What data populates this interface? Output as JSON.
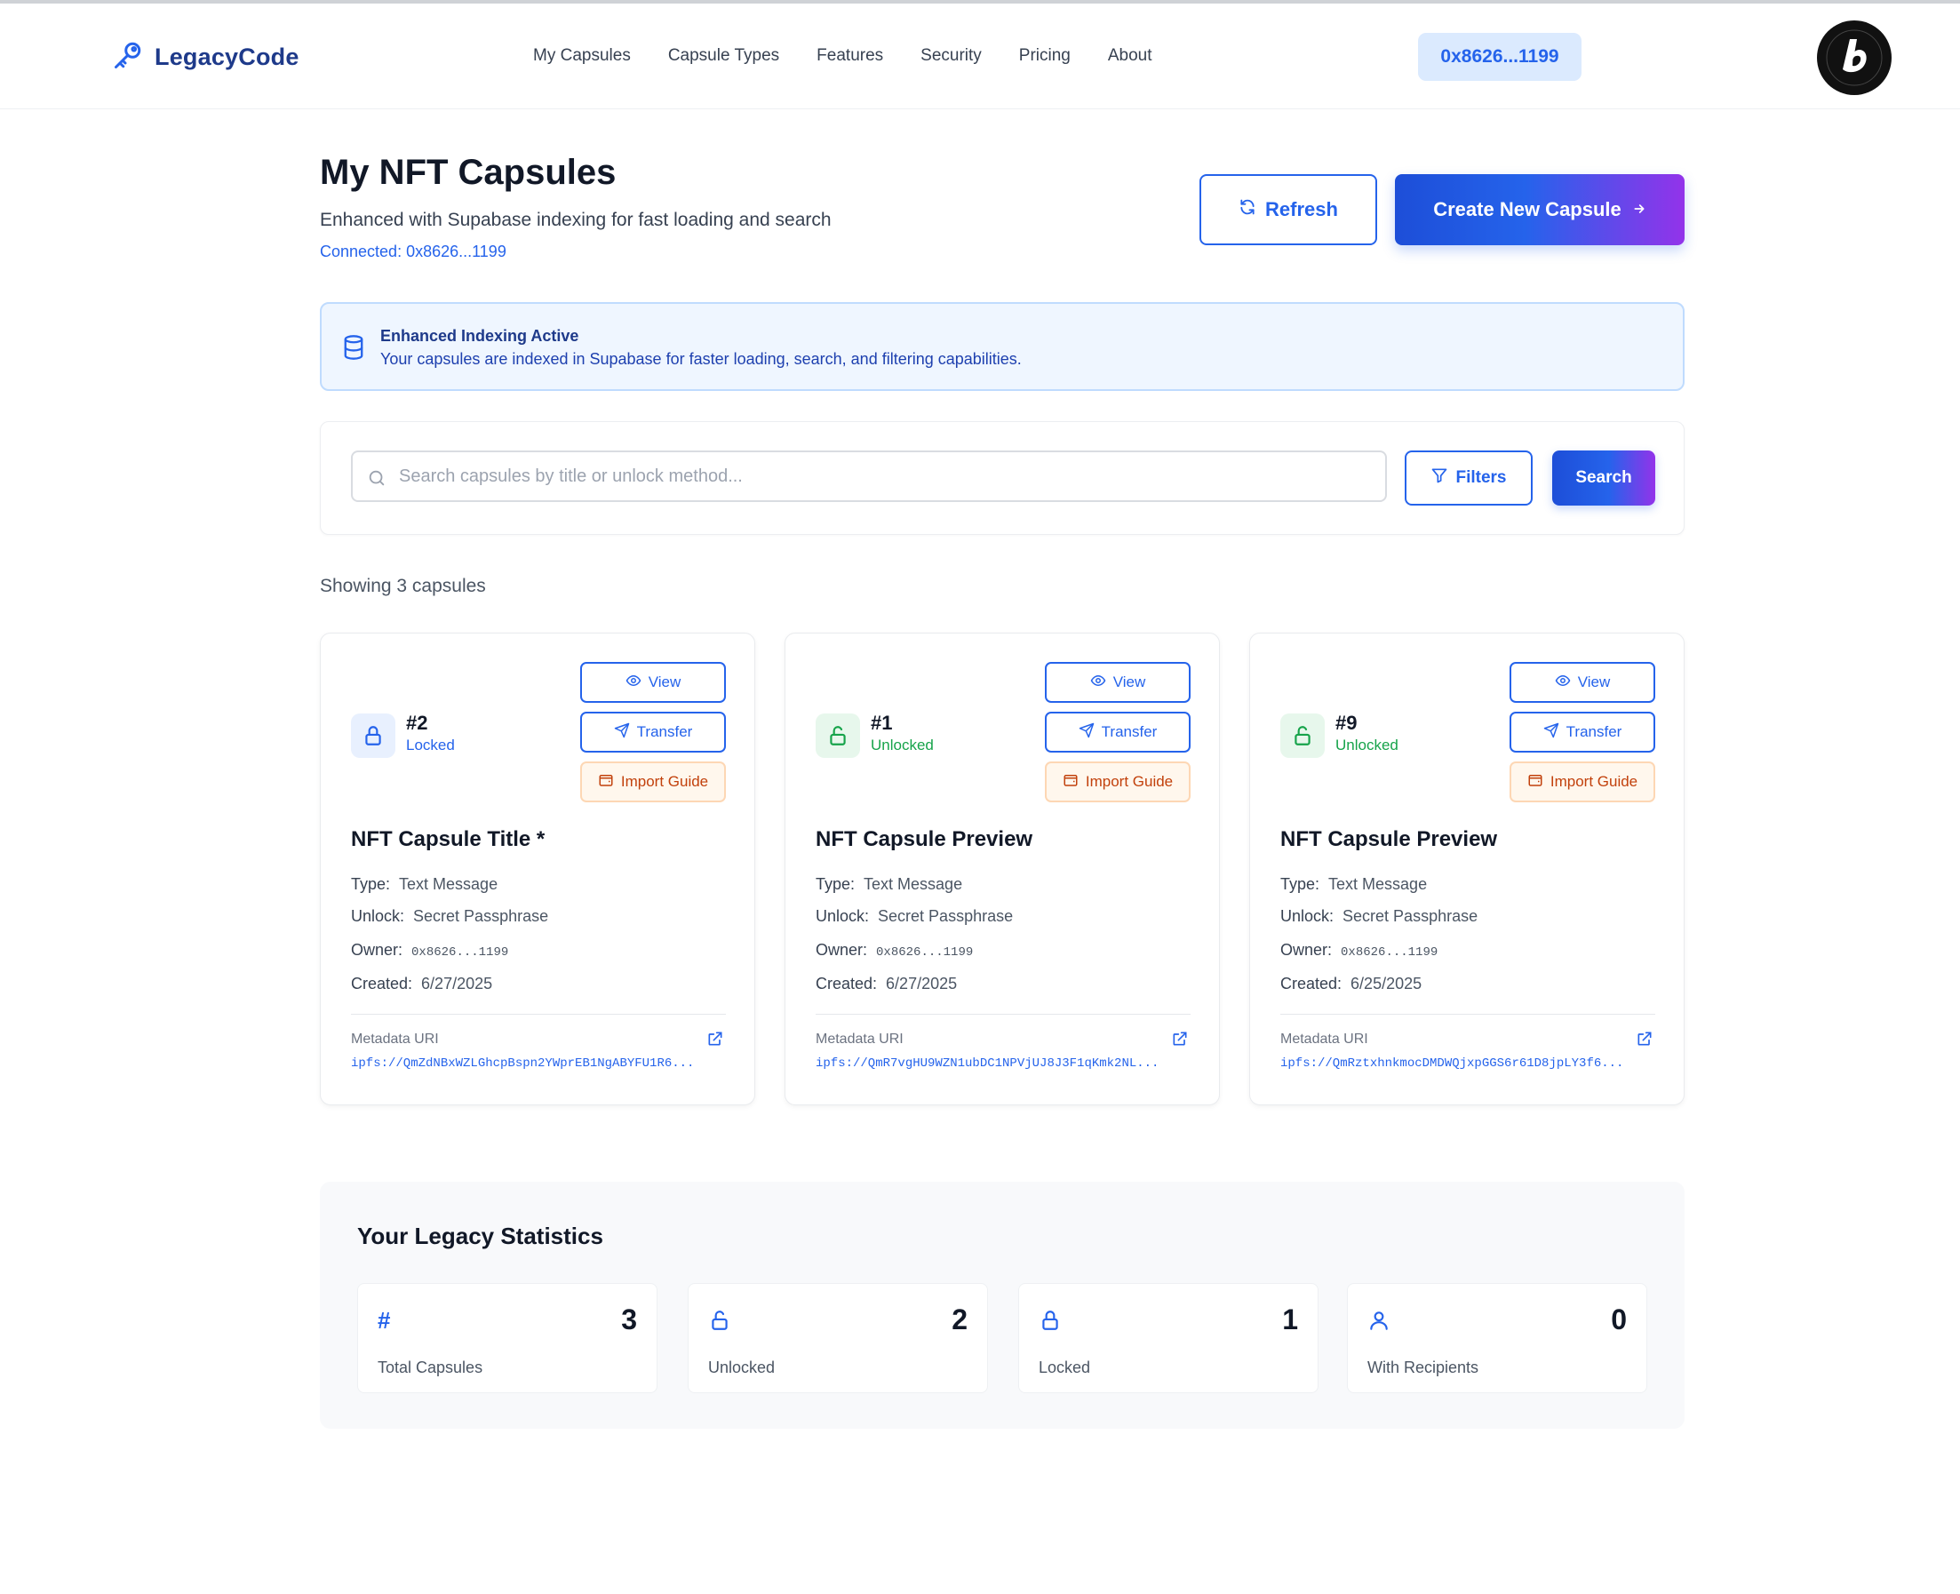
{
  "header": {
    "logo": "LegacyCode",
    "nav": [
      "My Capsules",
      "Capsule Types",
      "Features",
      "Security",
      "Pricing",
      "About"
    ],
    "wallet": "0x8626...1199"
  },
  "page": {
    "title": "My NFT Capsules",
    "subtitle": "Enhanced with Supabase indexing for fast loading and search",
    "connected": "Connected: 0x8626...1199",
    "refresh_label": "Refresh",
    "create_label": "Create New Capsule"
  },
  "banner": {
    "title": "Enhanced Indexing Active",
    "text": "Your capsules are indexed in Supabase for faster loading, search, and filtering capabilities."
  },
  "search": {
    "placeholder": "Search capsules by title or unlock method...",
    "filters_label": "Filters",
    "search_label": "Search"
  },
  "showing": "Showing 3 capsules",
  "card_labels": {
    "view": "View",
    "transfer": "Transfer",
    "import": "Import Guide",
    "type": "Type:",
    "unlock": "Unlock:",
    "owner": "Owner:",
    "created": "Created:",
    "metadata_uri": "Metadata URI"
  },
  "capsules": [
    {
      "id": "#2",
      "status": "Locked",
      "title": "NFT Capsule Title *",
      "type": "Text Message",
      "unlock": "Secret Passphrase",
      "owner": "0x8626...1199",
      "created": "6/27/2025",
      "uri": "ipfs://QmZdNBxWZLGhcpBspn2YWprEB1NgABYFU1R6..."
    },
    {
      "id": "#1",
      "status": "Unlocked",
      "title": "NFT Capsule Preview",
      "type": "Text Message",
      "unlock": "Secret Passphrase",
      "owner": "0x8626...1199",
      "created": "6/27/2025",
      "uri": "ipfs://QmR7vgHU9WZN1ubDC1NPVjUJ8J3F1qKmk2NL..."
    },
    {
      "id": "#9",
      "status": "Unlocked",
      "title": "NFT Capsule Preview",
      "type": "Text Message",
      "unlock": "Secret Passphrase",
      "owner": "0x8626...1199",
      "created": "6/25/2025",
      "uri": "ipfs://QmRztxhnkmocDMDWQjxpGGS6r61D8jpLY3f6..."
    }
  ],
  "stats": {
    "title": "Your Legacy Statistics",
    "items": [
      {
        "icon": "hash-icon",
        "value": "3",
        "label": "Total Capsules"
      },
      {
        "icon": "unlock-icon",
        "value": "2",
        "label": "Unlocked"
      },
      {
        "icon": "lock-icon",
        "value": "1",
        "label": "Locked"
      },
      {
        "icon": "user-icon",
        "value": "0",
        "label": "With Recipients"
      }
    ]
  },
  "colors": {
    "primary": "#2563eb",
    "accent_purple": "#9333ea",
    "locked": "#2563eb",
    "unlocked": "#16a34a",
    "import_orange": "#c2410c"
  }
}
